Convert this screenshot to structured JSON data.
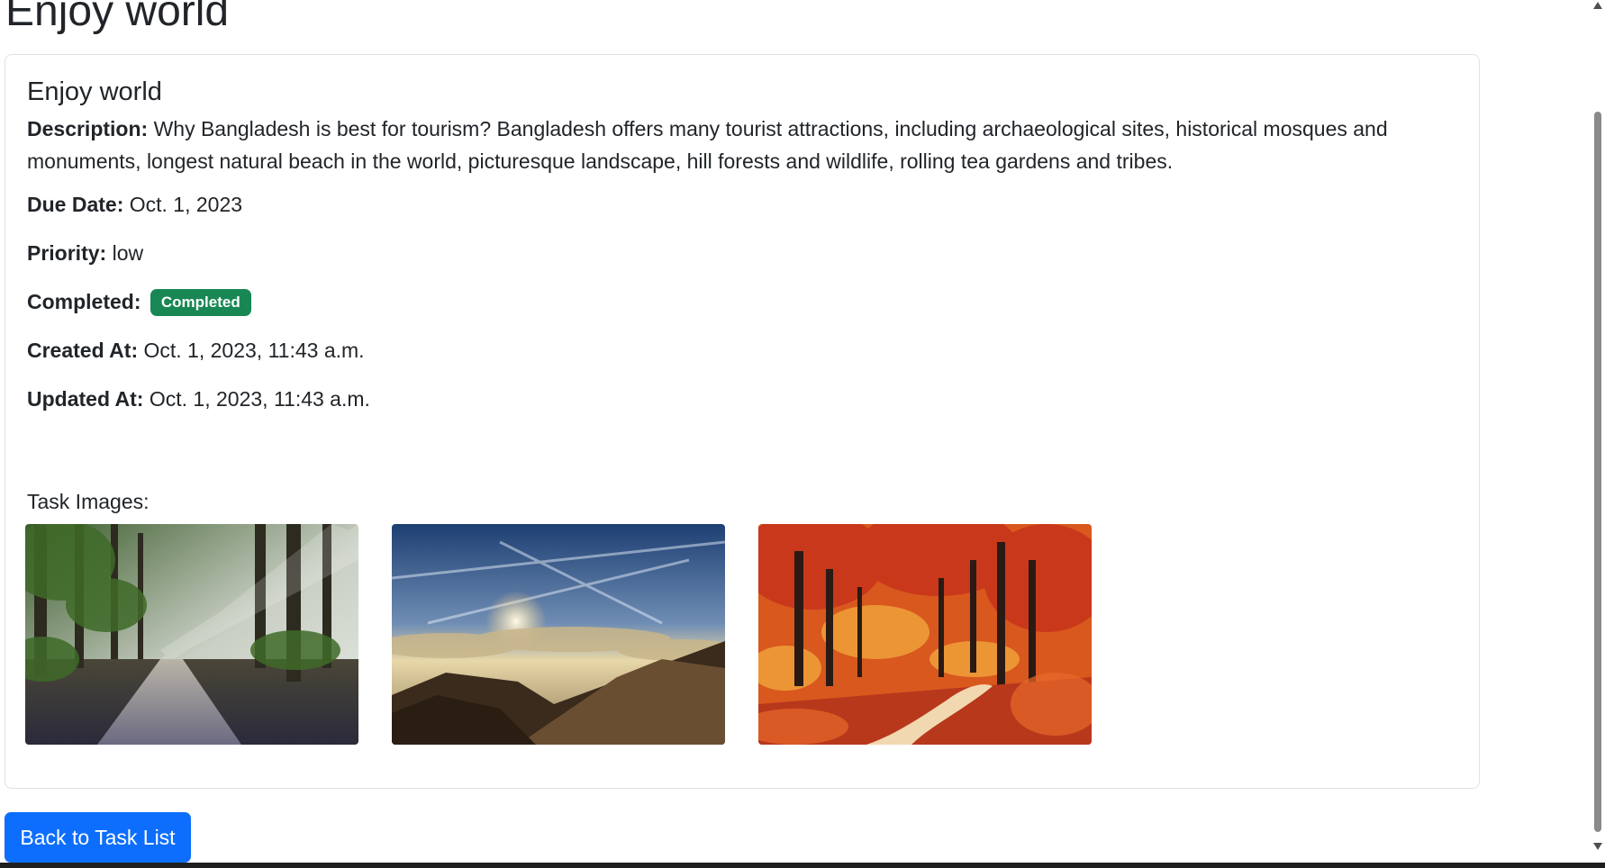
{
  "page": {
    "title": "Enjoy world"
  },
  "task": {
    "title": "Enjoy world",
    "description_label": "Description:",
    "description": "Why Bangladesh is best for tourism? Bangladesh offers many tourist attractions, including archaeological sites, historical mosques and monuments, longest natural beach in the world, picturesque landscape, hill forests and wildlife, rolling tea gardens and tribes.",
    "due_date_label": "Due Date:",
    "due_date": "Oct. 1, 2023",
    "priority_label": "Priority:",
    "priority": "low",
    "completed_label": "Completed:",
    "completed_badge": "Completed",
    "created_label": "Created At:",
    "created_at": "Oct. 1, 2023, 11:43 a.m.",
    "updated_label": "Updated At:",
    "updated_at": "Oct. 1, 2023, 11:43 a.m.",
    "images_label": "Task Images:"
  },
  "actions": {
    "back_label": "Back to Task List"
  },
  "colors": {
    "primary": "#0d6efd",
    "success": "#198754",
    "text": "#212529",
    "border": "#dee2e6"
  }
}
